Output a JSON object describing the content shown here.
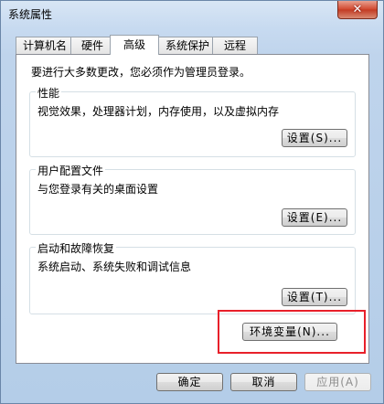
{
  "window": {
    "title": "系统属性",
    "close_glyph": "✕"
  },
  "tabs": [
    "计算机名",
    "硬件",
    "高级",
    "系统保护",
    "远程"
  ],
  "active_tab": "高级",
  "intro_text": "要进行大多数更改，您必须作为管理员登录。",
  "groups": [
    {
      "title": "性能",
      "description": "视觉效果，处理器计划，内存使用，以及虚拟内存",
      "button": "设置(S)..."
    },
    {
      "title": "用户配置文件",
      "description": "与您登录有关的桌面设置",
      "button": "设置(E)..."
    },
    {
      "title": "启动和故障恢复",
      "description": "系统启动、系统失败和调试信息",
      "button": "设置(T)..."
    }
  ],
  "env_button": "环境变量(N)...",
  "footer": {
    "ok": "确定",
    "cancel": "取消",
    "apply": "应用(A)"
  },
  "colors": {
    "highlight": "#e8202a",
    "close_button": "#c23a22"
  }
}
